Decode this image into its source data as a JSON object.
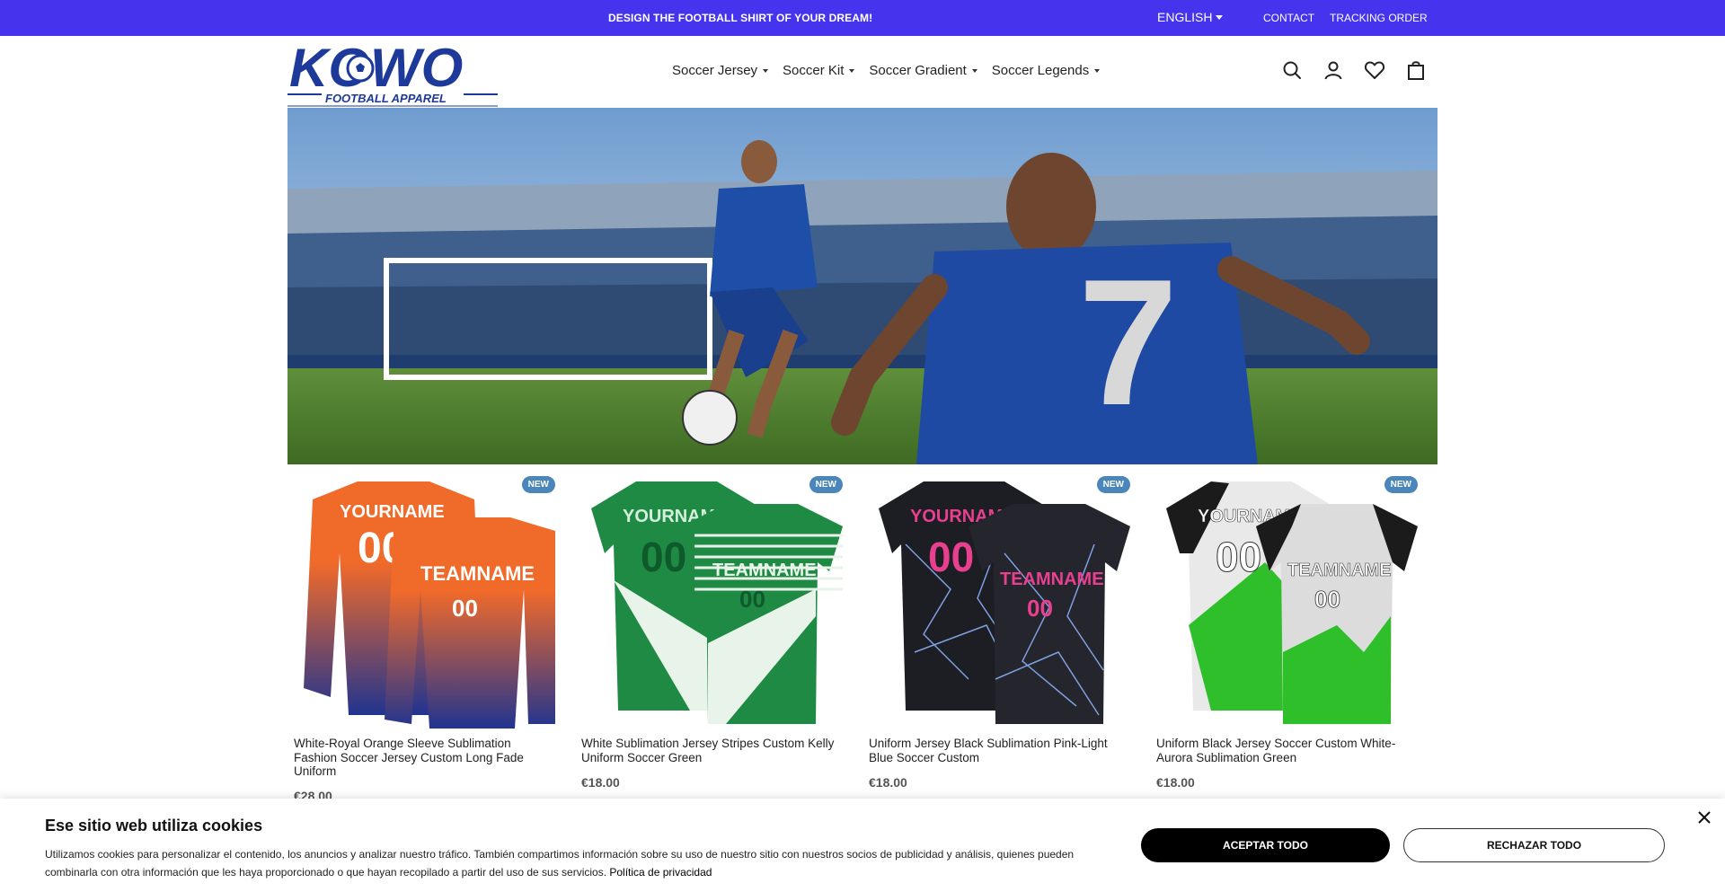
{
  "topbar": {
    "promo": "DESIGN THE FOOTBALL SHIRT OF YOUR DREAM!",
    "language": "ENGLISH",
    "contact": "CONTACT",
    "tracking": "TRACKING ORDER"
  },
  "logo": {
    "brand": "KOWO",
    "tagline": "FOOTBALL APPAREL"
  },
  "nav": [
    {
      "label": "Soccer Jersey"
    },
    {
      "label": "Soccer Kit"
    },
    {
      "label": "Soccer Gradient"
    },
    {
      "label": "Soccer Legends"
    }
  ],
  "header_icons": [
    "search-icon",
    "user-icon",
    "heart-icon",
    "bag-icon"
  ],
  "products": [
    {
      "badge": "NEW",
      "title": "White-Royal Orange Sleeve Sublimation Fashion Soccer Jersey Custom Long Fade Uniform",
      "price": "€28.00"
    },
    {
      "badge": "NEW",
      "title": "White Sublimation Jersey Stripes Custom Kelly Uniform Soccer Green",
      "price": "€18.00"
    },
    {
      "badge": "NEW",
      "title": "Uniform Jersey Black Sublimation Pink-Light Blue Soccer Custom",
      "price": "€18.00"
    },
    {
      "badge": "NEW",
      "title": "Uniform Black Jersey Soccer Custom White-Aurora Sublimation Green",
      "price": "€18.00"
    }
  ],
  "cookie": {
    "title": "Ese sitio web utiliza cookies",
    "text": "Utilizamos cookies para personalizar el contenido, los anuncios y analizar nuestro tráfico. También compartimos información sobre su uso de nuestro sitio con nuestros socios de publicidad y análisis, quienes pueden combinarla con otra información que les haya proporcionado o que hayan recopilado a partir del uso de sus servicios.",
    "policy_link": "Política de privacidad",
    "accept": "ACEPTAR TODO",
    "reject": "RECHAZAR TODO"
  },
  "colors": {
    "topbar": "#4533ee",
    "logo_blue": "#1d3a9a",
    "badge": "#4a86b9"
  }
}
